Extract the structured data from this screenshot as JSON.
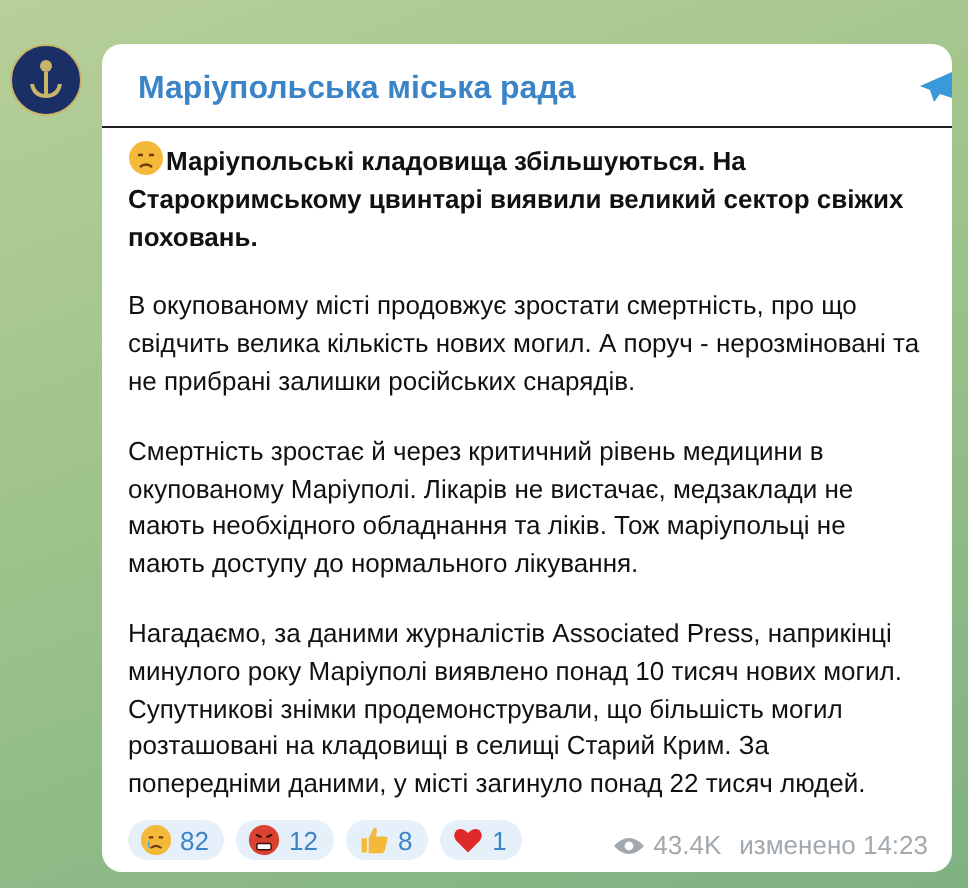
{
  "channel": {
    "name": "Маріупольська міська рада"
  },
  "post": {
    "paragraphs": [
      {
        "kind": "headline",
        "text": "Маріупольські кладовища збільшуються. На Старокримському цвинтарі виявили великий сектор свіжих поховань."
      },
      {
        "kind": "body",
        "text": "В окупованому місті продовжує зростати смертність, про що свідчить велика кількість нових могил. А поруч - нерозміновані та не прибрані залишки російських снарядів."
      },
      {
        "kind": "body",
        "text": "Смертність зростає й через критичний рівень медицини в окупованому Маріуполі. Лікарів не вистачає, медзаклади не мають необхідного обладнання та ліків. Тож маріупольці не мають доступу до нормального лікування."
      },
      {
        "kind": "body",
        "text": "Нагадаємо, за даними журналістів Associated Press, наприкінці минулого року Маріуполі виявлено понад 10 тисяч нових могил. Супутникові знімки продемонстрували, що більшість могил розташовані на кладовищі в селищі Старий Крим. За попередніми даними, у місті загинуло понад 22 тисяч людей."
      }
    ],
    "reactions": [
      {
        "kind": "crying",
        "count": "82"
      },
      {
        "kind": "angry",
        "count": "12"
      },
      {
        "kind": "thumbs",
        "count": "8"
      },
      {
        "kind": "heart",
        "count": "1"
      }
    ],
    "views": "43.4K",
    "edited": "изменено 14:23"
  }
}
